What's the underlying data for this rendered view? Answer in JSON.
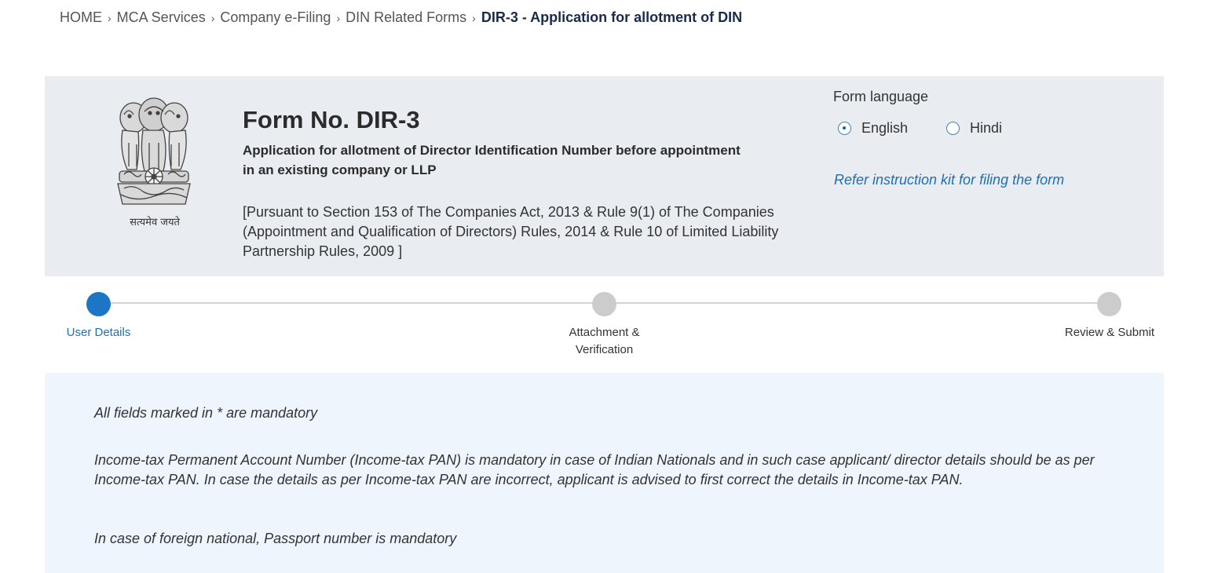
{
  "breadcrumb": {
    "items": [
      "HOME",
      "MCA Services",
      "Company e-Filing",
      "DIN Related Forms"
    ],
    "current": "DIR-3 - Application for allotment of DIN",
    "separator": "›"
  },
  "header": {
    "emblem_icon": "national-emblem-icon",
    "motto": "सत्यमेव जयते",
    "form_no": "Form No. DIR-3",
    "subtitle": "Application for allotment of Director Identification Number before appointment in an existing company or LLP",
    "pursuant": "[Pursuant to Section 153 of The Companies Act, 2013 & Rule 9(1) of The Companies (Appointment and Qualification of Directors) Rules, 2014 & Rule 10 of Limited Liability Partnership Rules, 2009 ]",
    "language": {
      "title": "Form language",
      "options": [
        "English",
        "Hindi"
      ],
      "selected": "English"
    },
    "instruction_link": "Refer instruction kit for filing the form"
  },
  "stepper": {
    "steps": [
      "User Details",
      "Attachment & Verification",
      "Review & Submit"
    ],
    "active": "User Details"
  },
  "notice": {
    "mandatory": "All fields marked in  * are mandatory",
    "pan": "Income-tax Permanent Account Number (Income-tax PAN) is mandatory in case of Indian Nationals and in such case applicant/ director details should be as per Income-tax PAN. In case the details as per Income-tax PAN are incorrect, applicant is advised to first correct the details in Income-tax PAN.",
    "passport": "In case of foreign national, Passport number is mandatory"
  },
  "colors": {
    "accent": "#1c76c5",
    "link": "#1f6fb2",
    "header_bg": "#e9ecf1",
    "info_bg": "#eef5fd",
    "inactive_step": "#cccccc"
  }
}
